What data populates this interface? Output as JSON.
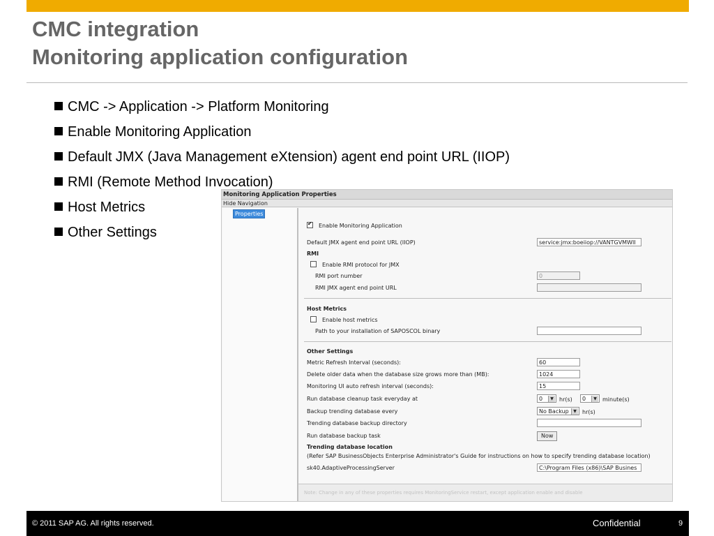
{
  "slide": {
    "title_line1": "CMC integration",
    "title_line2": "Monitoring application configuration",
    "bullets": [
      "CMC -> Application -> Platform Monitoring",
      "Enable Monitoring Application",
      "Default JMX (Java Management eXtension) agent end point URL (IIOP)",
      "RMI (Remote Method Invocation)",
      "Host Metrics",
      "Other Settings"
    ],
    "accent_color": "#f0ab00"
  },
  "screenshot": {
    "window_title": "Monitoring Application Properties",
    "hide_navigation": "Hide Navigation",
    "properties_tab": "Properties",
    "enable_monitoring": {
      "label": "Enable Monitoring Application",
      "checked": true
    },
    "jmx_url": {
      "label": "Default JMX agent end point URL (IIOP)",
      "value": "service:jmx:boeiiop://VANTGVMWII"
    },
    "rmi": {
      "header": "RMI",
      "enable_label": "Enable RMI protocol for JMX",
      "enable_checked": false,
      "port_label": "RMI port number",
      "port_value": "0",
      "url_label": "RMI JMX agent end point URL",
      "url_value": ""
    },
    "host_metrics": {
      "header": "Host Metrics",
      "enable_label": "Enable host metrics",
      "enable_checked": false,
      "path_label": "Path to your installation of SAPOSCOL binary",
      "path_value": ""
    },
    "other": {
      "header": "Other Settings",
      "refresh_label": "Metric Refresh Interval (seconds):",
      "refresh_value": "60",
      "delete_label": "Delete older data when the database size grows more than (MB):",
      "delete_value": "1024",
      "ui_refresh_label": "Monitoring UI auto refresh interval (seconds):",
      "ui_refresh_value": "15",
      "cleanup_label": "Run database cleanup task everyday at",
      "cleanup_hr": "0",
      "hr_unit": "hr(s)",
      "cleanup_min": "0",
      "minute_unit": "minute(s)",
      "backup_label": "Backup trending database every",
      "backup_value": "No Backup",
      "backup_unit": "hr(s)",
      "backup_dir_label": "Trending database backup directory",
      "backup_dir_value": "",
      "backup_task_label": "Run database backup task",
      "now_button": "Now"
    },
    "trending": {
      "header": "Trending database location",
      "note": "(Refer SAP BusinessObjects Enterprise Administrator's Guide for instructions on how to specify trending database location)",
      "server_label": "sk40.AdaptiveProcessingServer",
      "server_value": "C:\\Program Files (x86)\\SAP Busines"
    },
    "footer_note": "Note: Change in any of these properties requires MonitoringService restart, except application enable and disable"
  },
  "footer": {
    "copyright": "©  2011 SAP AG. All rights reserved.",
    "confidential": "Confidential",
    "page": "9"
  }
}
